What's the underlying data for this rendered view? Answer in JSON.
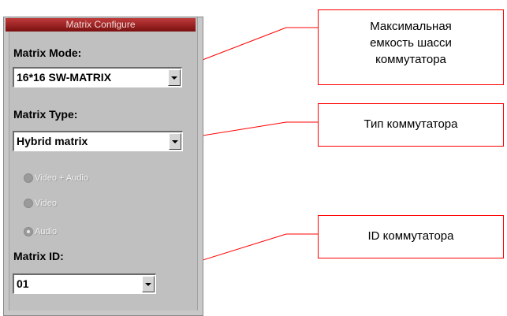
{
  "panel": {
    "title": "Matrix Configure",
    "matrix_mode": {
      "label": "Matrix Mode:",
      "value": "16*16 SW-MATRIX"
    },
    "matrix_type": {
      "label": "Matrix Type:",
      "value": "Hybrid matrix"
    },
    "signal_options": [
      {
        "label": "Video + Audio",
        "checked": false
      },
      {
        "label": "Video",
        "checked": false
      },
      {
        "label": "Audio",
        "checked": true
      }
    ],
    "matrix_id": {
      "label": "Matrix ID:",
      "value": "01"
    }
  },
  "callouts": {
    "capacity": {
      "line1": "Максимальная",
      "line2": "емкость шасси",
      "line3": "коммутатора"
    },
    "type": {
      "text": "Тип коммутатора"
    },
    "id": {
      "text": "ID коммутатора"
    }
  },
  "colors": {
    "callout_line": "#ff0000",
    "title_bar": "#8b1a1a",
    "panel_bg": "#c0c0c0"
  }
}
